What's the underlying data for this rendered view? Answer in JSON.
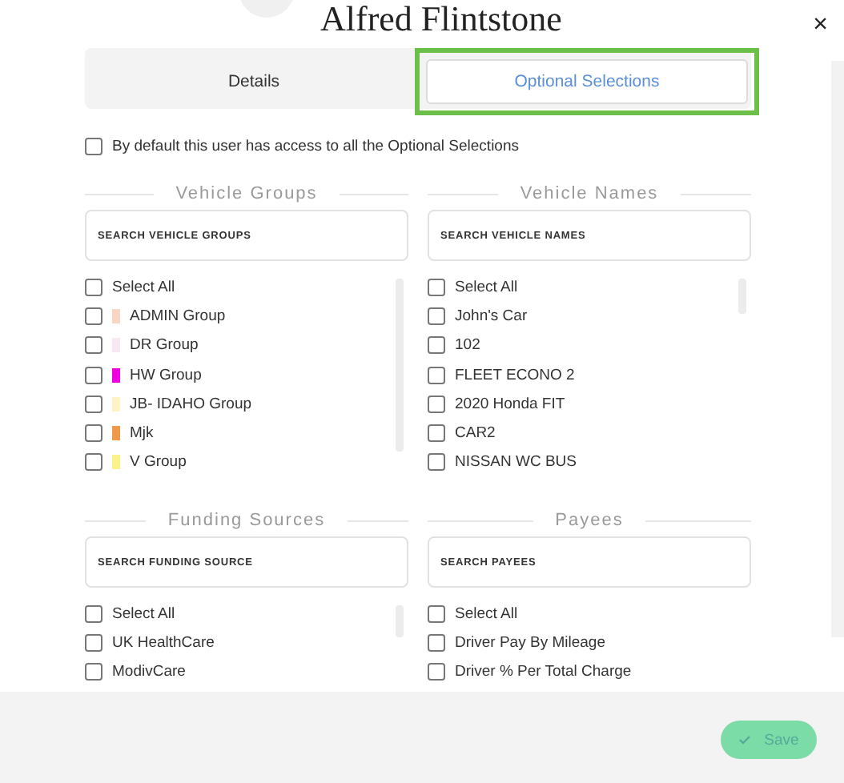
{
  "header": {
    "title": "Alfred Flintstone"
  },
  "close": {
    "icon": "×"
  },
  "tabs": [
    {
      "label": "Details",
      "selected": false,
      "highlighted": false
    },
    {
      "label": "Optional Selections",
      "selected": true,
      "highlighted": true
    }
  ],
  "default_access": {
    "label": "By default this user has access to all the Optional Selections",
    "checked": false
  },
  "sections": [
    {
      "title": "Vehicle Groups",
      "placeholder": "SEARCH VEHICLE GROUPS",
      "items": [
        {
          "label": "Select All",
          "checked": false
        },
        {
          "label": "ADMIN Group",
          "checked": false,
          "color": "#f9d6c4"
        },
        {
          "label": "DR Group",
          "checked": false,
          "color": "#f7e9f4"
        },
        {
          "label": "HW Group",
          "checked": false,
          "color": "#f000e0"
        },
        {
          "label": "JB- IDAHO Group",
          "checked": false,
          "color": "#fdf3c4"
        },
        {
          "label": "Mjk",
          "checked": false,
          "color": "#f0994a"
        },
        {
          "label": "V Group",
          "checked": false,
          "color": "#fbf28a"
        }
      ]
    },
    {
      "title": "Vehicle Names",
      "placeholder": "SEARCH VEHICLE NAMES",
      "items": [
        {
          "label": "Select All",
          "checked": false
        },
        {
          "label": "John's Car",
          "checked": false
        },
        {
          "label": "102",
          "checked": false
        },
        {
          "label": "FLEET ECONO 2",
          "checked": false
        },
        {
          "label": "2020 Honda FIT",
          "checked": false
        },
        {
          "label": "CAR2",
          "checked": false
        },
        {
          "label": "NISSAN WC BUS",
          "checked": false
        }
      ]
    },
    {
      "title": "Funding Sources",
      "placeholder": "SEARCH FUNDING SOURCE",
      "items": [
        {
          "label": "Select All",
          "checked": false
        },
        {
          "label": "UK HealthCare",
          "checked": false
        },
        {
          "label": "ModivCare",
          "checked": false
        }
      ]
    },
    {
      "title": "Payees",
      "placeholder": "SEARCH PAYEES",
      "items": [
        {
          "label": "Select All",
          "checked": false
        },
        {
          "label": "Driver Pay By Mileage",
          "checked": false
        },
        {
          "label": "Driver % Per Total Charge",
          "checked": false
        }
      ]
    }
  ],
  "footer": {
    "save_button": {
      "label": "Save",
      "disabled": true
    }
  }
}
